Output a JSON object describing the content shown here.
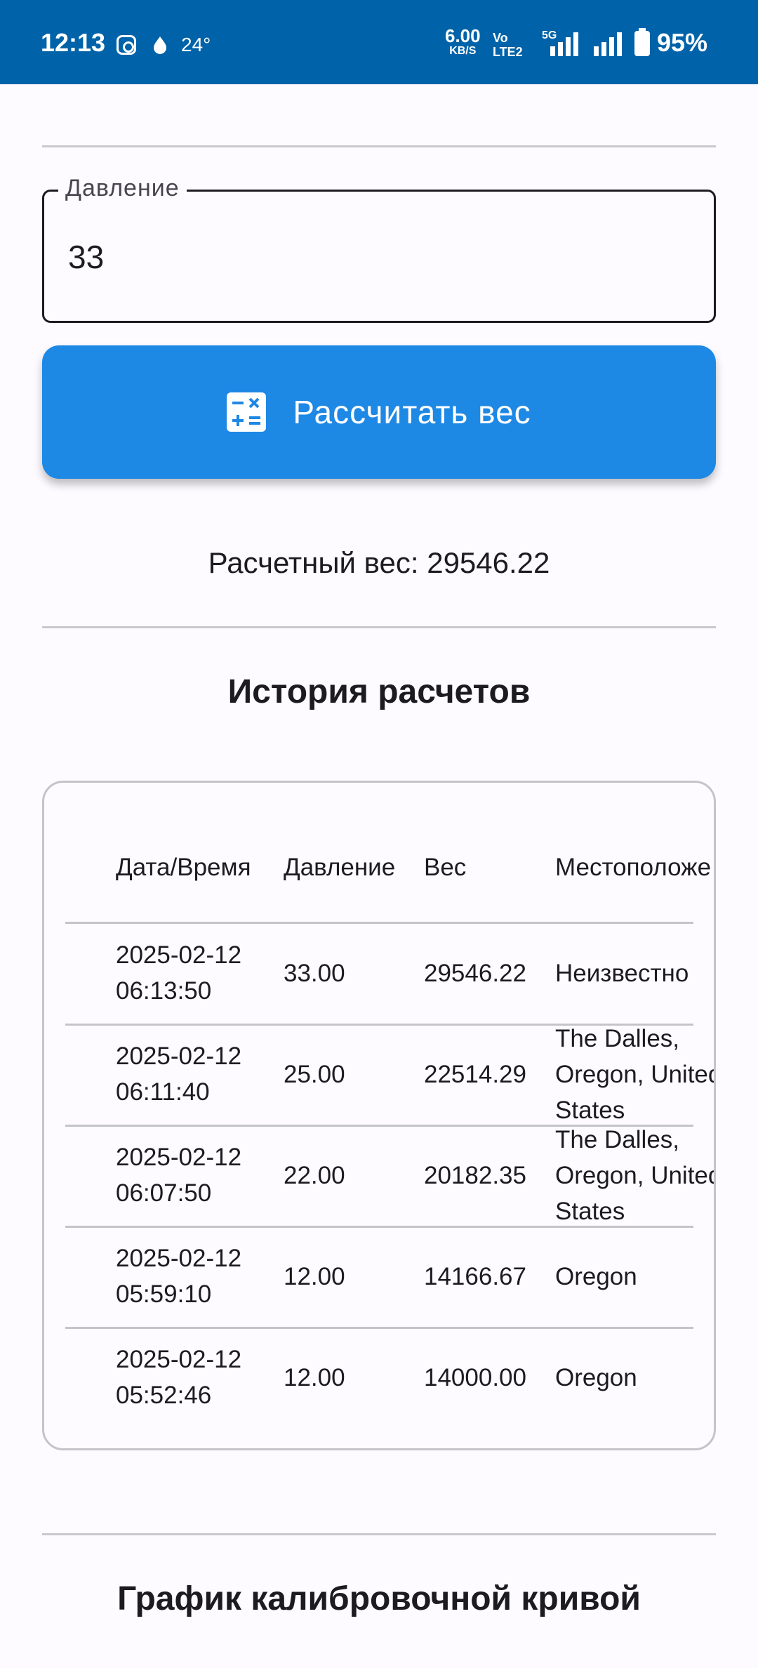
{
  "status_bar": {
    "time": "12:13",
    "temperature": "24°",
    "net_speed": "6.00",
    "net_unit": "KB/S",
    "volte_top": "Vo",
    "volte_bottom": "LTE2",
    "network": "5G",
    "battery": "95%"
  },
  "form": {
    "pressure_label": "Давление",
    "pressure_value": "33",
    "calc_button_label": "Рассчитать вес",
    "calc_icon": "calculate-icon"
  },
  "result": {
    "text": "Расчетный вес: 29546.22"
  },
  "history": {
    "title": "История расчетов",
    "columns": [
      "Дата/Время",
      "Давление",
      "Вес",
      "Местоположе"
    ],
    "rows": [
      {
        "date": "2025-02-12",
        "time": "06:13:50",
        "pressure": "33.00",
        "weight": "29546.22",
        "location": [
          "Неизвестно"
        ]
      },
      {
        "date": "2025-02-12",
        "time": "06:11:40",
        "pressure": "25.00",
        "weight": "22514.29",
        "location": [
          "The Dalles,",
          "Oregon, United",
          "States"
        ]
      },
      {
        "date": "2025-02-12",
        "time": "06:07:50",
        "pressure": "22.00",
        "weight": "20182.35",
        "location": [
          "The Dalles,",
          "Oregon, United",
          "States"
        ]
      },
      {
        "date": "2025-02-12",
        "time": "05:59:10",
        "pressure": "12.00",
        "weight": "14166.67",
        "location": [
          "Oregon"
        ]
      },
      {
        "date": "2025-02-12",
        "time": "05:52:46",
        "pressure": "12.00",
        "weight": "14000.00",
        "location": [
          "Oregon"
        ]
      }
    ]
  },
  "chart_section": {
    "title": "График калибровочной кривой"
  },
  "colors": {
    "status_bar": "#0062a8",
    "primary_button": "#1e88e5",
    "background": "#fdfbff"
  }
}
